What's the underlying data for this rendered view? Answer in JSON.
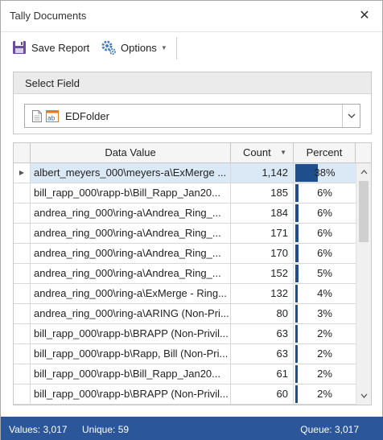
{
  "window": {
    "title": "Tally Documents"
  },
  "toolbar": {
    "save_label": "Save Report",
    "options_label": "Options"
  },
  "select_field": {
    "header": "Select Field",
    "value": "EDFolder"
  },
  "grid": {
    "columns": {
      "value": "Data Value",
      "count": "Count",
      "percent": "Percent"
    },
    "rows": [
      {
        "value": "albert_meyers_000\\meyers-a\\ExMerge ...",
        "count": "1,142",
        "percent": "38%",
        "fraction": 0.38,
        "selected": true
      },
      {
        "value": "bill_rapp_000\\rapp-b\\Bill_Rapp_Jan20...",
        "count": "185",
        "percent": "6%",
        "fraction": 0.06
      },
      {
        "value": "andrea_ring_000\\ring-a\\Andrea_Ring_...",
        "count": "184",
        "percent": "6%",
        "fraction": 0.06
      },
      {
        "value": "andrea_ring_000\\ring-a\\Andrea_Ring_...",
        "count": "171",
        "percent": "6%",
        "fraction": 0.06
      },
      {
        "value": "andrea_ring_000\\ring-a\\Andrea_Ring_...",
        "count": "170",
        "percent": "6%",
        "fraction": 0.06
      },
      {
        "value": "andrea_ring_000\\ring-a\\Andrea_Ring_...",
        "count": "152",
        "percent": "5%",
        "fraction": 0.05
      },
      {
        "value": "andrea_ring_000\\ring-a\\ExMerge - Ring...",
        "count": "132",
        "percent": "4%",
        "fraction": 0.04
      },
      {
        "value": "andrea_ring_000\\ring-a\\ARING (Non-Pri...",
        "count": "80",
        "percent": "3%",
        "fraction": 0.03
      },
      {
        "value": "bill_rapp_000\\rapp-b\\BRAPP (Non-Privil...",
        "count": "63",
        "percent": "2%",
        "fraction": 0.02
      },
      {
        "value": "bill_rapp_000\\rapp-b\\Rapp, Bill (Non-Pri...",
        "count": "63",
        "percent": "2%",
        "fraction": 0.02
      },
      {
        "value": "bill_rapp_000\\rapp-b\\Bill_Rapp_Jan20...",
        "count": "61",
        "percent": "2%",
        "fraction": 0.02
      },
      {
        "value": "bill_rapp_000\\rapp-b\\BRAPP (Non-Privil...",
        "count": "60",
        "percent": "2%",
        "fraction": 0.02
      }
    ]
  },
  "status": {
    "values": "Values: 3,017",
    "unique": "Unique: 59",
    "queue": "Queue: 3,017"
  },
  "colors": {
    "accent": "#2b579a",
    "bar": "#1f4e8c",
    "selected_row": "#dbe9f6"
  },
  "icons": {
    "close": "close-icon",
    "save": "save-icon",
    "options": "gear-icon",
    "dropdown": "chevron-down-icon"
  }
}
